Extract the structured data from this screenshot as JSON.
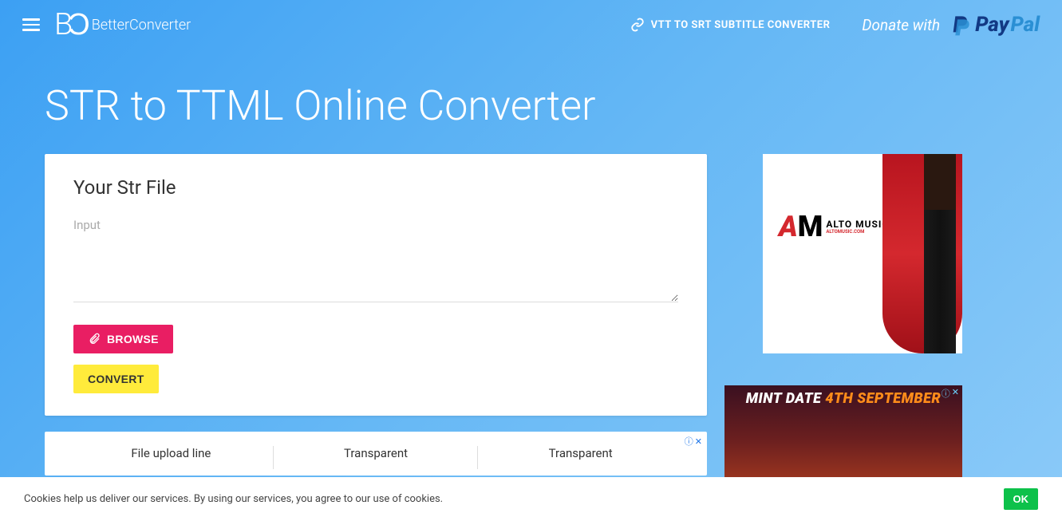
{
  "header": {
    "brand": "BetterConverter",
    "link_label": "VTT TO SRT SUBTITLE CONVERTER",
    "donate_prefix": "Donate with",
    "paypal_p1": "Pay",
    "paypal_p2": "Pal"
  },
  "page": {
    "title": "STR to TTML Online Converter"
  },
  "form": {
    "heading": "Your Str File",
    "input_placeholder": "Input",
    "browse_label": "BROWSE",
    "convert_label": "CONVERT"
  },
  "ads": {
    "row": [
      "File upload line",
      "Transparent",
      "Transparent"
    ],
    "alto_brand_a": "A",
    "alto_brand_m": "M",
    "alto_text": "ALTO MUSIC",
    "alto_sub": "ALTOMUSIC.COM",
    "mint_prefix": "MINT DATE ",
    "mint_date": "4TH SEPTEMBER",
    "info_symbol": "ⓘ",
    "close_symbol": "✕"
  },
  "cookie": {
    "text": "Cookies help us deliver our services. By using our services, you agree to our use of cookies.",
    "ok": "OK"
  }
}
